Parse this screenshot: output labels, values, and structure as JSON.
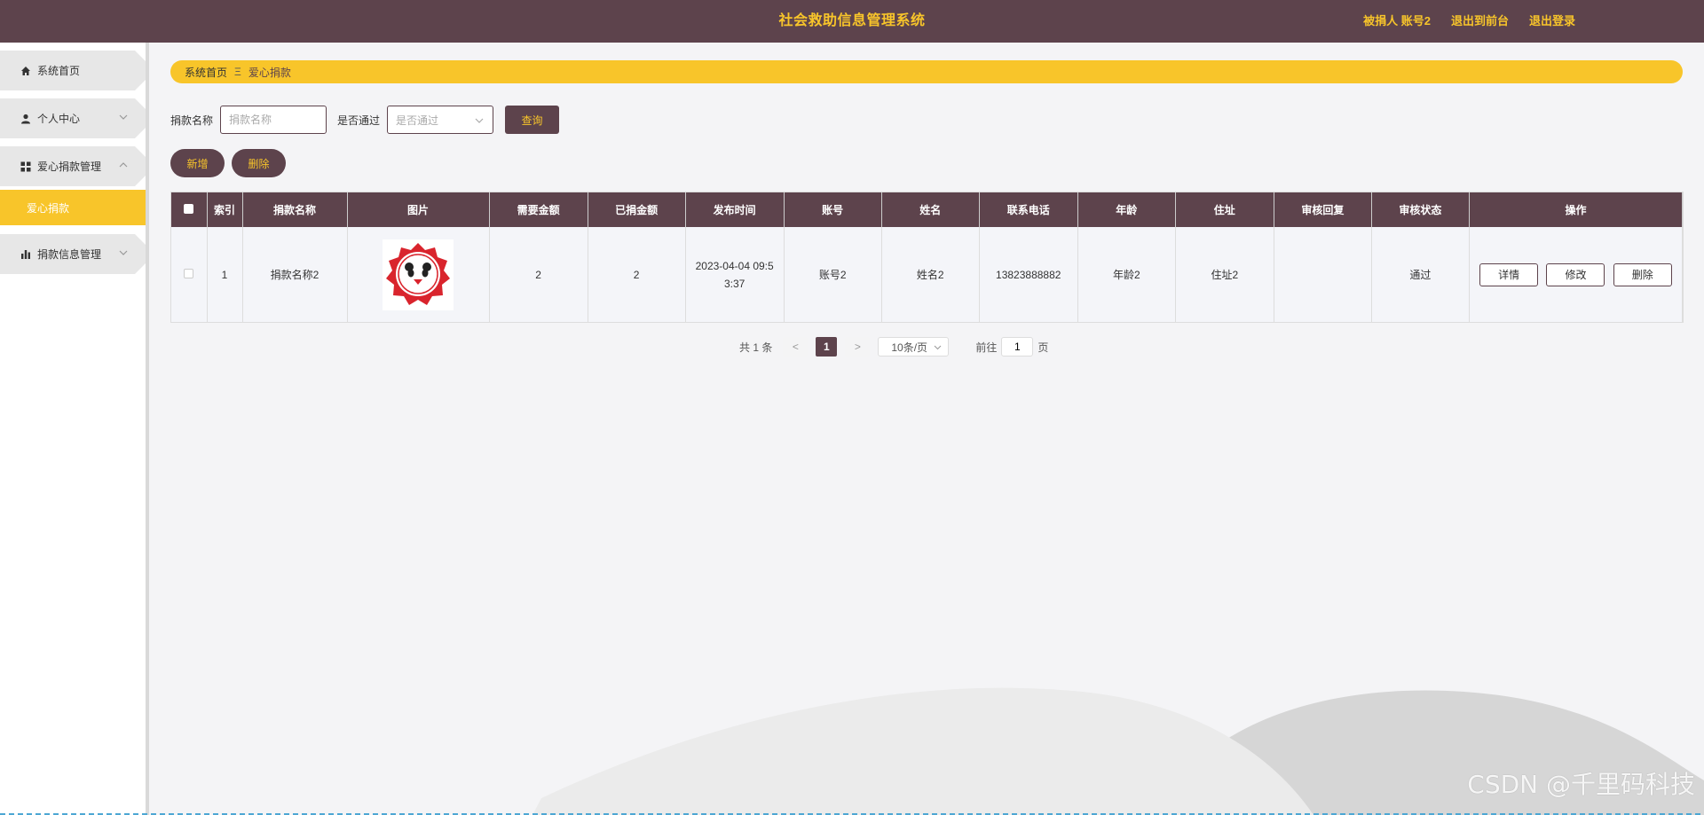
{
  "header": {
    "title": "社会救助信息管理系统",
    "user_label": "被捐人 账号2",
    "to_front_label": "退出到前台",
    "logout_label": "退出登录"
  },
  "sidebar": {
    "items": [
      {
        "label": "系统首页",
        "icon": "home-icon"
      },
      {
        "label": "个人中心",
        "icon": "user-icon"
      },
      {
        "label": "爱心捐款管理",
        "icon": "grid-icon"
      },
      {
        "label": "爱心捐款",
        "icon": ""
      },
      {
        "label": "捐款信息管理",
        "icon": "bar-chart-icon"
      }
    ]
  },
  "breadcrumb": {
    "home": "系统首页",
    "separator": "Ξ",
    "current": "爱心捐款"
  },
  "search": {
    "name_label": "捐款名称",
    "name_placeholder": "捐款名称",
    "pass_label": "是否通过",
    "pass_placeholder": "是否通过",
    "query_label": "查询"
  },
  "actions": {
    "add_label": "新增",
    "delete_label": "删除"
  },
  "table": {
    "headers": [
      "索引",
      "捐款名称",
      "图片",
      "需要金额",
      "已捐金额",
      "发布时间",
      "账号",
      "姓名",
      "联系电话",
      "年龄",
      "住址",
      "审核回复",
      "审核状态",
      "操作"
    ],
    "rows": [
      {
        "index": "1",
        "name": "捐款名称2",
        "need": "2",
        "donated": "2",
        "time": "2023-04-04 09:53:37",
        "account": "账号2",
        "realname": "姓名2",
        "phone": "13823888882",
        "age": "年龄2",
        "address": "住址2",
        "reply": "",
        "status": "通过",
        "btn_detail": "详情",
        "btn_edit": "修改",
        "btn_delete": "删除"
      }
    ]
  },
  "pager": {
    "total": "共 1 条",
    "prev": "<",
    "current_page": "1",
    "next": ">",
    "page_size": "10条/页",
    "goto_prefix": "前往",
    "goto_value": "1",
    "goto_suffix": "页"
  },
  "watermark": "CSDN @千里码科技",
  "colors": {
    "primary": "#5d434c",
    "accent": "#f8c52a",
    "background": "#f4f4f6"
  }
}
